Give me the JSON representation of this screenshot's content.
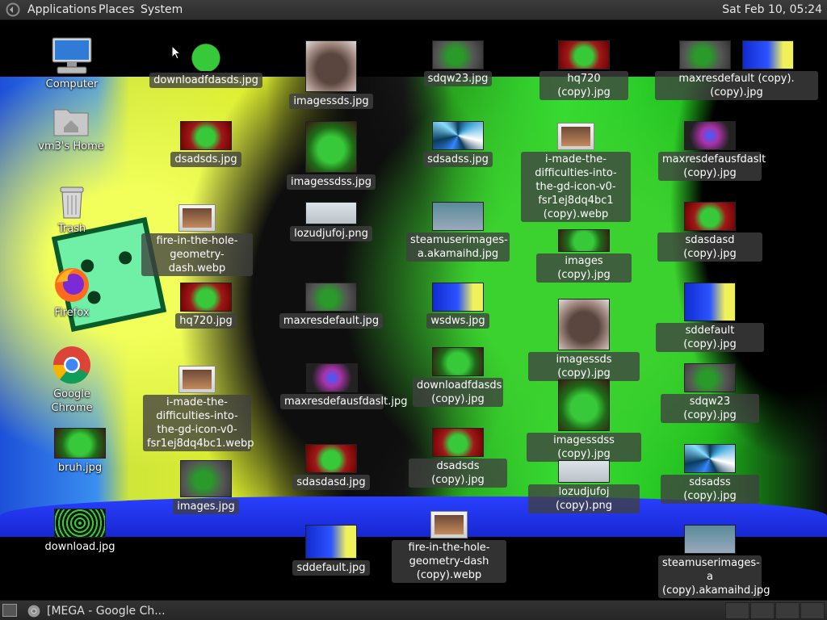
{
  "top_panel": {
    "menus": [
      "Applications",
      "Places",
      "System"
    ],
    "clock": "Sat Feb 10, 05:24"
  },
  "desktop": {
    "system_icons": [
      {
        "label": "Computer",
        "icon": "computer-icon"
      },
      {
        "label": "vm3's Home",
        "icon": "home-folder-icon"
      },
      {
        "label": "Trash",
        "icon": "trash-icon"
      },
      {
        "label": "Firefox",
        "icon": "firefox-icon"
      },
      {
        "label": "Google Chrome",
        "icon": "chrome-icon"
      },
      {
        "label": "bruh.jpg",
        "icon": "image-file-icon"
      },
      {
        "label": "download.jpg",
        "icon": "image-file-icon"
      }
    ],
    "files": [
      "downloadfdasds.jpg",
      "dsadsds.jpg",
      "fire-in-the-hole-geometry-dash.webp",
      "hq720.jpg",
      "i-made-the-difficulties-into-the-gd-icon-v0-fsr1ej8dq4bc1.webp",
      "images.jpg",
      "imagessds.jpg",
      "imagessdss.jpg",
      "lozudjufoj.png",
      "maxresdefault.jpg",
      "maxresdefausfdaslt.jpg",
      "sdasdasd.jpg",
      "sddefault.jpg",
      "sdqw23.jpg",
      "sdsadss.jpg",
      "steamuserimages-a.akamaihd.jpg",
      "wsdws.jpg",
      "downloadfdasds (copy).jpg",
      "dsadsds (copy).jpg",
      "fire-in-the-hole-geometry-dash (copy).webp",
      "hq720 (copy).jpg",
      "i-made-the-difficulties-into-the-gd-icon-v0-fsr1ej8dq4bc1 (copy).webp",
      "images (copy).jpg",
      "imagessds (copy).jpg",
      "imagessdss (copy).jpg",
      "lozudjufoj (copy).png",
      "maxresdefault (copy).  (copy).jpg",
      "maxresdefausfdaslt (copy).jpg",
      "sdasdasd (copy).jpg",
      "sddefault (copy).jpg",
      "sdqw23 (copy).jpg",
      "sdsadss (copy).jpg",
      "steamuserimages-a (copy).akamaihd.jpg"
    ]
  },
  "bottom_panel": {
    "task_title": "[MEGA - Google Ch...",
    "task_icon": "chrome-icon"
  }
}
